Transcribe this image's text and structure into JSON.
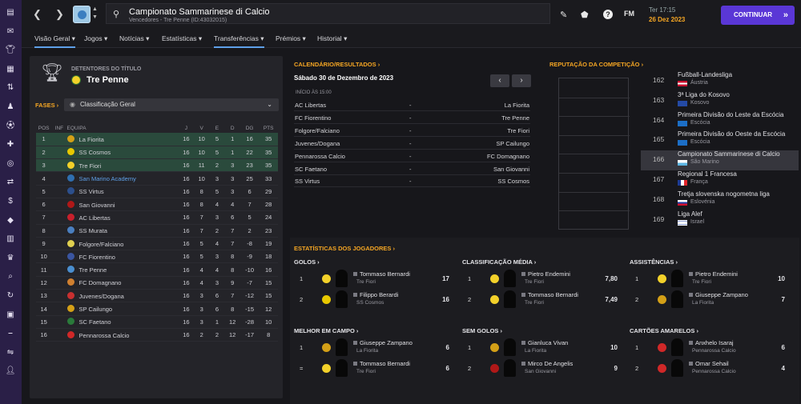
{
  "rail_icons": [
    "menu-icon",
    "inbox-icon",
    "squad-icon",
    "tactics-icon",
    "data-hub-icon",
    "staff-icon",
    "training-icon",
    "medical-icon",
    "scouting-icon",
    "transfers-icon",
    "finances-icon",
    "club-vision-icon",
    "schedule-icon",
    "competitions-icon",
    "search-icon",
    "refresh-icon",
    "save-icon",
    "tools-icon",
    "network-icon",
    "person-icon"
  ],
  "header": {
    "title": "Campionato Sammarinese di Calcio",
    "subtitle": "Vencedores - Tre Penne (ID:43032015)",
    "date_line1": "Ter 17:15",
    "date_line2": "26 Dez 2023",
    "continue": "CONTINUAR",
    "fm": "FM"
  },
  "tabs": [
    "Visão Geral",
    "Jogos",
    "Notícias",
    "Estatísticas",
    "Transferências",
    "Prémios",
    "Historial"
  ],
  "title_holder": {
    "label": "DETENTORES DO TÍTULO",
    "team": "Tre Penne"
  },
  "phases": {
    "label": "FASES",
    "selected": "Classificação Geral"
  },
  "league": {
    "headers": [
      "POS",
      "INF",
      "EQUIPA",
      "J",
      "V",
      "E",
      "D",
      "DG",
      "PTS"
    ],
    "rows": [
      [
        "1",
        "",
        "La Fiorita",
        "16",
        "10",
        "5",
        "1",
        "16",
        "35"
      ],
      [
        "2",
        "",
        "SS Cosmos",
        "16",
        "10",
        "5",
        "1",
        "22",
        "35"
      ],
      [
        "3",
        "",
        "Tre Fiori",
        "16",
        "11",
        "2",
        "3",
        "23",
        "35"
      ],
      [
        "4",
        "",
        "San Marino Academy",
        "16",
        "10",
        "3",
        "3",
        "25",
        "33"
      ],
      [
        "5",
        "",
        "SS Virtus",
        "16",
        "8",
        "5",
        "3",
        "6",
        "29"
      ],
      [
        "6",
        "",
        "San Giovanni",
        "16",
        "8",
        "4",
        "4",
        "7",
        "28"
      ],
      [
        "7",
        "",
        "AC Libertas",
        "16",
        "7",
        "3",
        "6",
        "5",
        "24"
      ],
      [
        "8",
        "",
        "SS Murata",
        "16",
        "7",
        "2",
        "7",
        "2",
        "23"
      ],
      [
        "9",
        "",
        "Folgore/Falciano",
        "16",
        "5",
        "4",
        "7",
        "-8",
        "19"
      ],
      [
        "10",
        "",
        "FC Fiorentino",
        "16",
        "5",
        "3",
        "8",
        "-9",
        "18"
      ],
      [
        "11",
        "",
        "Tre Penne",
        "16",
        "4",
        "4",
        "8",
        "-10",
        "16"
      ],
      [
        "12",
        "",
        "FC Domagnano",
        "16",
        "4",
        "3",
        "9",
        "-7",
        "15"
      ],
      [
        "13",
        "",
        "Juvenes/Dogana",
        "16",
        "3",
        "6",
        "7",
        "-12",
        "15"
      ],
      [
        "14",
        "",
        "SP Cailungo",
        "16",
        "3",
        "6",
        "8",
        "-15",
        "12"
      ],
      [
        "15",
        "",
        "SC Faetano",
        "16",
        "3",
        "1",
        "12",
        "-28",
        "10"
      ],
      [
        "16",
        "",
        "Pennarossa Calcio",
        "16",
        "2",
        "2",
        "12",
        "-17",
        "8"
      ]
    ]
  },
  "fixtures": {
    "title": "CALENDÁRIO/RESULTADOS",
    "date": "Sábado 30 de Dezembro de 2023",
    "time": "INÍCIO ÀS 15:00",
    "matches": [
      [
        "AC Libertas",
        "-",
        "La Fiorita"
      ],
      [
        "FC Fiorentino",
        "-",
        "Tre Penne"
      ],
      [
        "Folgore/Falciano",
        "-",
        "Tre Fiori"
      ],
      [
        "Juvenes/Dogana",
        "-",
        "SP Cailungo"
      ],
      [
        "Pennarossa Calcio",
        "-",
        "FC Domagnano"
      ],
      [
        "SC Faetano",
        "-",
        "San Giovanni"
      ],
      [
        "SS Virtus",
        "-",
        "SS Cosmos"
      ]
    ]
  },
  "reputation": {
    "title": "REPUTAÇÃO DA COMPETIÇÃO",
    "rows": [
      [
        "162",
        "Fußball-Landesliga",
        "Áustria"
      ],
      [
        "163",
        "3ª Liga do Kosovo",
        "Kosovo"
      ],
      [
        "164",
        "Primeira Divisão do Leste da Escócia",
        "Escócia"
      ],
      [
        "165",
        "Primeira Divisão do Oeste da Escócia",
        "Escócia"
      ],
      [
        "166",
        "Campionato Sammarinese di Calcio",
        "São Marino"
      ],
      [
        "167",
        "Regional 1 Francesa",
        "França"
      ],
      [
        "168",
        "Tretja slovenska nogometna liga",
        "Eslovénia"
      ],
      [
        "169",
        "Liga Alef",
        "Israel"
      ]
    ]
  },
  "player_stats": {
    "title": "ESTATÍSTICAS DOS JOGADORES",
    "golos": {
      "label": "GOLOS",
      "rows": [
        [
          "1",
          "Tommaso Bernardi",
          "Tre Fiori",
          "17"
        ],
        [
          "2",
          "Filippo Berardi",
          "SS Cosmos",
          "16"
        ]
      ]
    },
    "media": {
      "label": "CLASSIFICAÇÃO MÉDIA",
      "rows": [
        [
          "1",
          "Pietro Endemini",
          "Tre Fiori",
          "7,80"
        ],
        [
          "2",
          "Tommaso Bernardi",
          "Tre Fiori",
          "7,49"
        ]
      ]
    },
    "assist": {
      "label": "ASSISTÊNCIAS",
      "rows": [
        [
          "1",
          "Pietro Endemini",
          "Tre Fiori",
          "10"
        ],
        [
          "2",
          "Giuseppe Zampano",
          "La Fiorita",
          "7"
        ]
      ]
    },
    "mvp": {
      "label": "MELHOR EM CAMPO",
      "rows": [
        [
          "1",
          "Giuseppe Zampano",
          "La Fiorita",
          "6"
        ],
        [
          "=",
          "Tommaso Bernardi",
          "Tre Fiori",
          "6"
        ]
      ]
    },
    "clean": {
      "label": "SEM GOLOS",
      "rows": [
        [
          "1",
          "Gianluca Vivan",
          "La Fiorita",
          "10"
        ],
        [
          "2",
          "Mirco De Angelis",
          "San Giovanni",
          "9"
        ]
      ]
    },
    "yellow": {
      "label": "CARTÕES AMARELOS",
      "rows": [
        [
          "1",
          "Anxhelo Isaraj",
          "Pennarossa Calcio",
          "6"
        ],
        [
          "2",
          "Omar Sehail",
          "Pennarossa Calcio",
          "4"
        ]
      ]
    }
  }
}
